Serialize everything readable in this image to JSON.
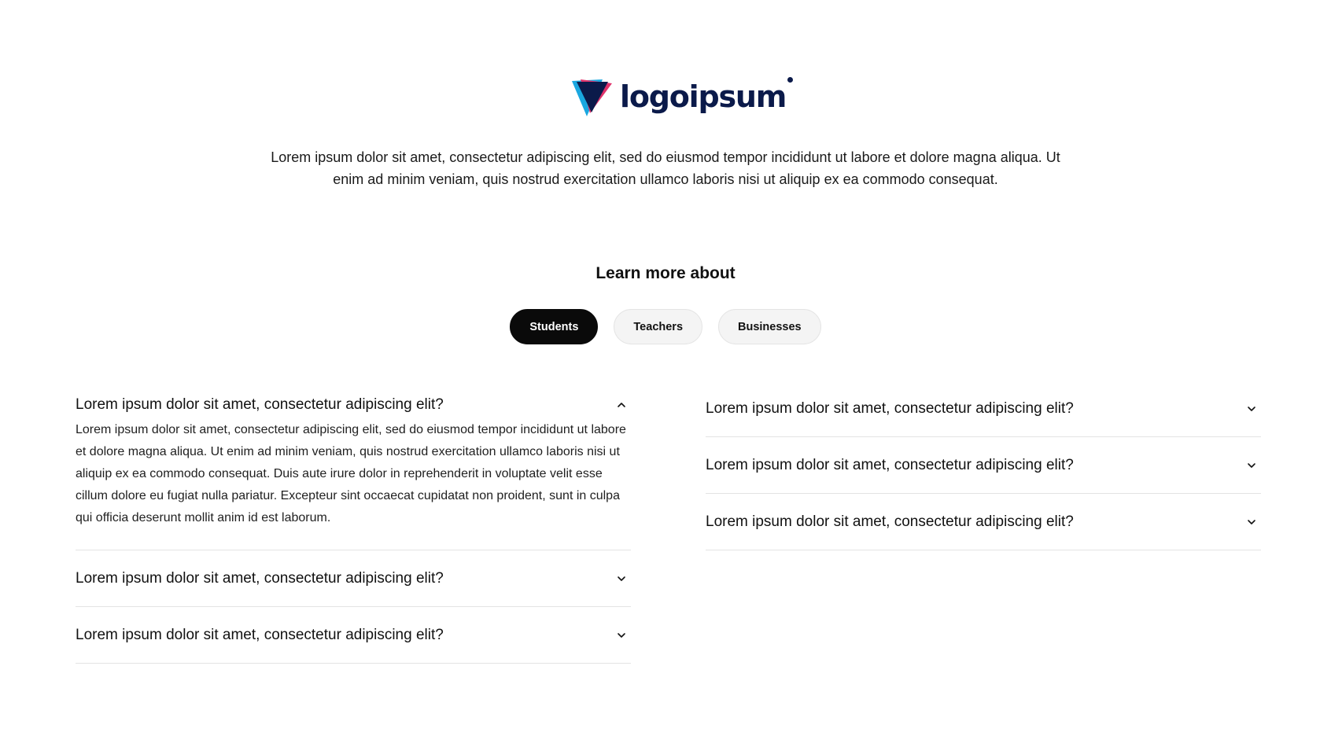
{
  "brand": {
    "name": "logoipsum",
    "colors": {
      "navy": "#0b1a4a",
      "pink": "#e0336b",
      "cyan": "#1aa7e0"
    }
  },
  "intro": {
    "text": "Lorem ipsum dolor sit amet, consectetur adipiscing elit, sed do eiusmod tempor incididunt ut labore et dolore magna aliqua. Ut enim ad minim veniam, quis nostrud exercitation ullamco laboris nisi ut aliquip ex ea commodo consequat."
  },
  "learn": {
    "title": "Learn more about"
  },
  "tabs": [
    {
      "label": "Students",
      "active": true
    },
    {
      "label": "Teachers",
      "active": false
    },
    {
      "label": "Businesses",
      "active": false
    }
  ],
  "faq": {
    "left": [
      {
        "question": "Lorem ipsum dolor sit amet, consectetur adipiscing elit?",
        "expanded": true,
        "answer": "Lorem ipsum dolor sit amet, consectetur adipiscing elit, sed do eiusmod tempor incididunt ut labore et dolore magna aliqua. Ut enim ad minim veniam, quis nostrud exercitation ullamco laboris nisi ut aliquip ex ea commodo consequat. Duis aute irure dolor in reprehenderit in voluptate velit esse cillum dolore eu fugiat nulla pariatur. Excepteur sint occaecat cupidatat non proident, sunt in culpa qui officia deserunt mollit anim id est laborum."
      },
      {
        "question": "Lorem ipsum dolor sit amet, consectetur adipiscing elit?",
        "expanded": false
      },
      {
        "question": "Lorem ipsum dolor sit amet, consectetur adipiscing elit?",
        "expanded": false
      }
    ],
    "right": [
      {
        "question": "Lorem ipsum dolor sit amet, consectetur adipiscing elit?",
        "expanded": false
      },
      {
        "question": "Lorem ipsum dolor sit amet, consectetur adipiscing elit?",
        "expanded": false
      },
      {
        "question": "Lorem ipsum dolor sit amet, consectetur adipiscing elit?",
        "expanded": false
      }
    ],
    "icons": {
      "expanded": "chevron-up-icon",
      "collapsed": "chevron-down-icon"
    }
  }
}
